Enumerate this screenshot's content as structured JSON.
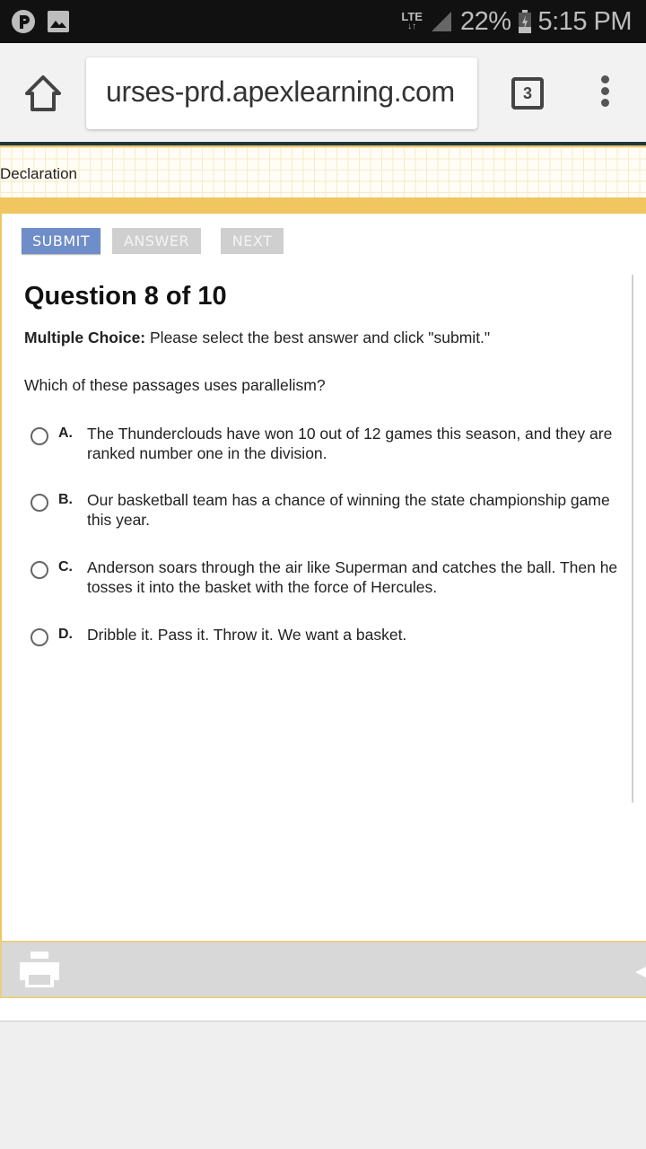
{
  "status_bar": {
    "network": "LTE",
    "battery": "22%",
    "time": "5:15 PM",
    "icons": [
      "pandora-icon",
      "image-icon",
      "signal-icon",
      "battery-charging-icon"
    ]
  },
  "browser": {
    "url": "urses-prd.apexlearning.com",
    "tab_count": "3",
    "icons": [
      "home-icon",
      "more-vert-icon"
    ]
  },
  "banner": {
    "title": "Declaration"
  },
  "quiz": {
    "buttons": {
      "submit": "SUBMIT",
      "answer": "ANSWER",
      "next": "NEXT"
    },
    "title": "Question 8 of 10",
    "instruction_label": "Multiple Choice:",
    "instruction_text": " Please select the best answer and click \"submit.\"",
    "prompt": "Which of these passages uses parallelism?",
    "options": [
      {
        "letter": "A.",
        "text": "The Thunderclouds have won 10 out of 12 games this season, and they are ranked number one in the division."
      },
      {
        "letter": "B.",
        "text": "Our basketball team has a chance of winning the state championship game this year."
      },
      {
        "letter": "C.",
        "text": "Anderson soars through the air like Superman and catches the ball. Then he tosses it into the basket with the force of Hercules."
      },
      {
        "letter": "D.",
        "text": "Dribble it. Pass it. Throw it. We want a basket."
      }
    ]
  },
  "footer": {
    "icons": [
      "print-icon",
      "back-arrow-icon"
    ]
  },
  "colors": {
    "submit_button": "#6f8dc8",
    "disabled_button": "#cfcfcf",
    "accent_yellow": "#f1c55f",
    "status_bar": "#111111"
  }
}
